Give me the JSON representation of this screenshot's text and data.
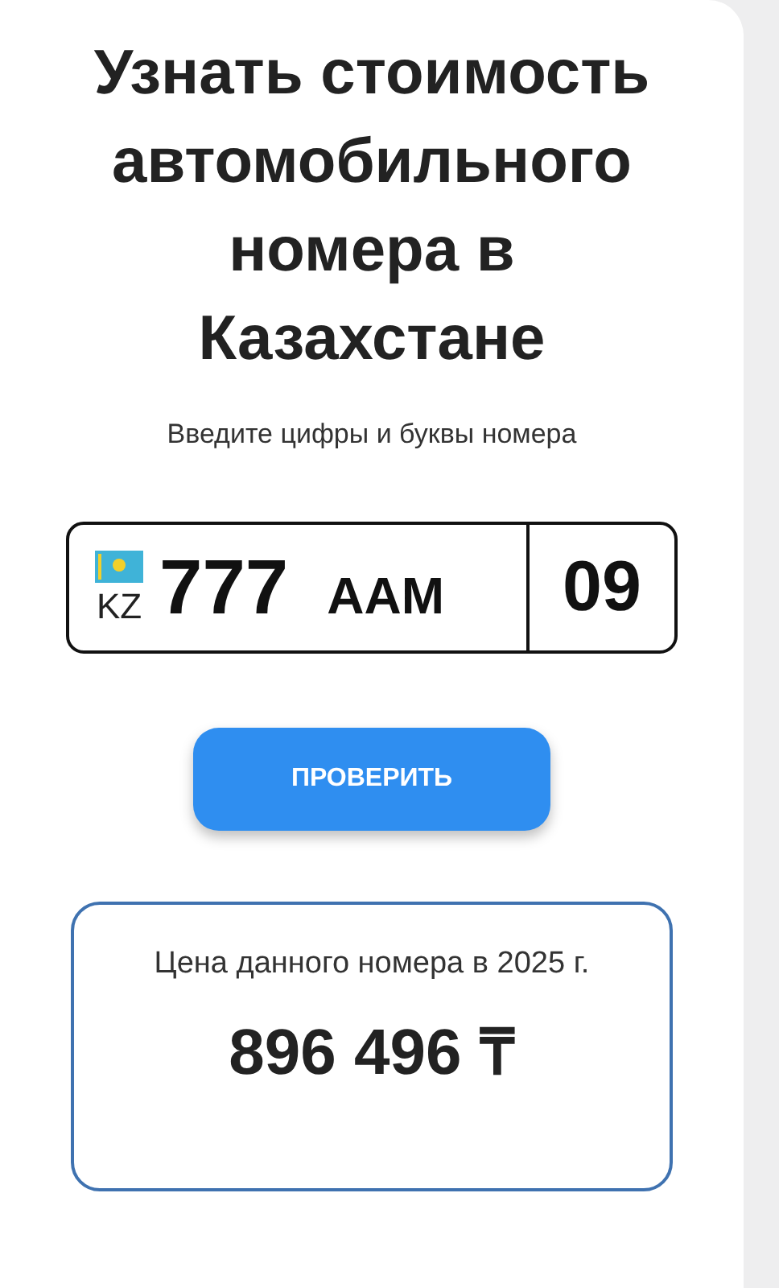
{
  "title": "Узнать стоимость автомобильного номера в Казахстане",
  "subtitle": "Введите цифры и буквы номера",
  "plate": {
    "country": "KZ",
    "digits": "777",
    "letters": "AAM",
    "region": "09"
  },
  "check_button": "ПРОВЕРИТЬ",
  "result": {
    "label": "Цена данного номера в 2025 г.",
    "price": "896 496 ₸"
  }
}
